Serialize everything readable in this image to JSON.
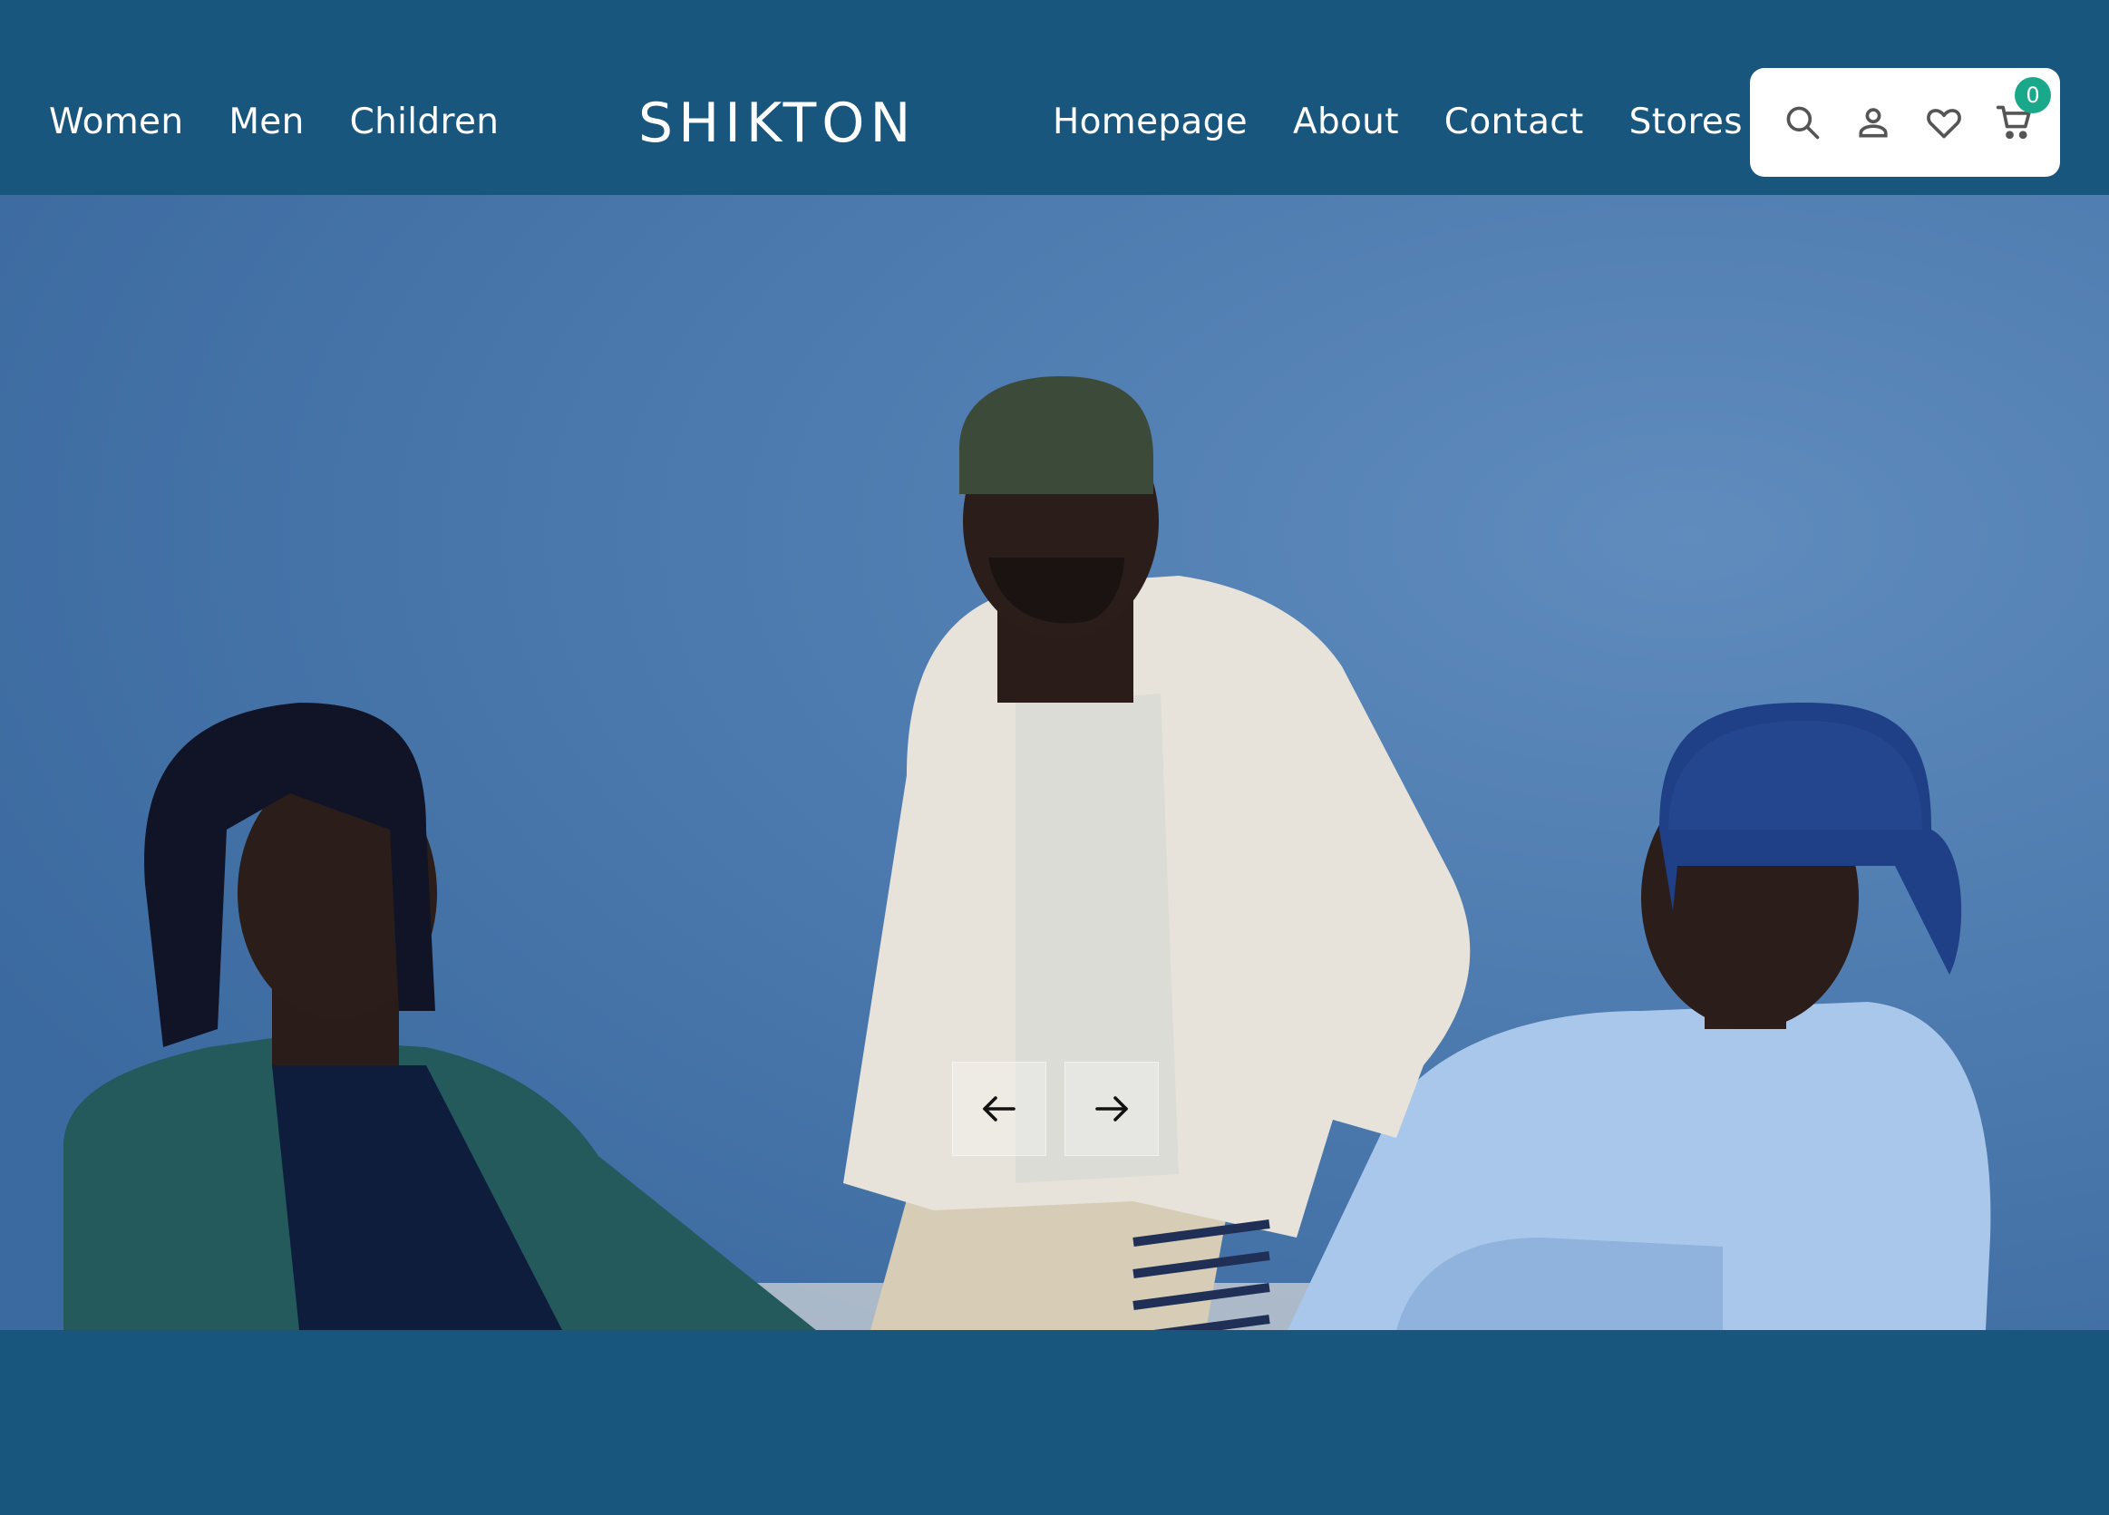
{
  "header": {
    "nav_left": [
      "Women",
      "Men",
      "Children"
    ],
    "logo": "SHIKTON",
    "nav_right": [
      "Homepage",
      "About",
      "Contact",
      "Stores"
    ],
    "cart_count": "0",
    "icons": [
      "search-icon",
      "user-icon",
      "heart-icon",
      "cart-icon"
    ]
  },
  "hero": {
    "image": "three-models-photo",
    "controls": [
      "arrow-left-icon",
      "arrow-right-icon"
    ]
  },
  "colors": {
    "header_bg": "#18567d",
    "hero_bg": "#4a78ad",
    "badge": "#19a98a",
    "text_light": "#ffffff"
  }
}
